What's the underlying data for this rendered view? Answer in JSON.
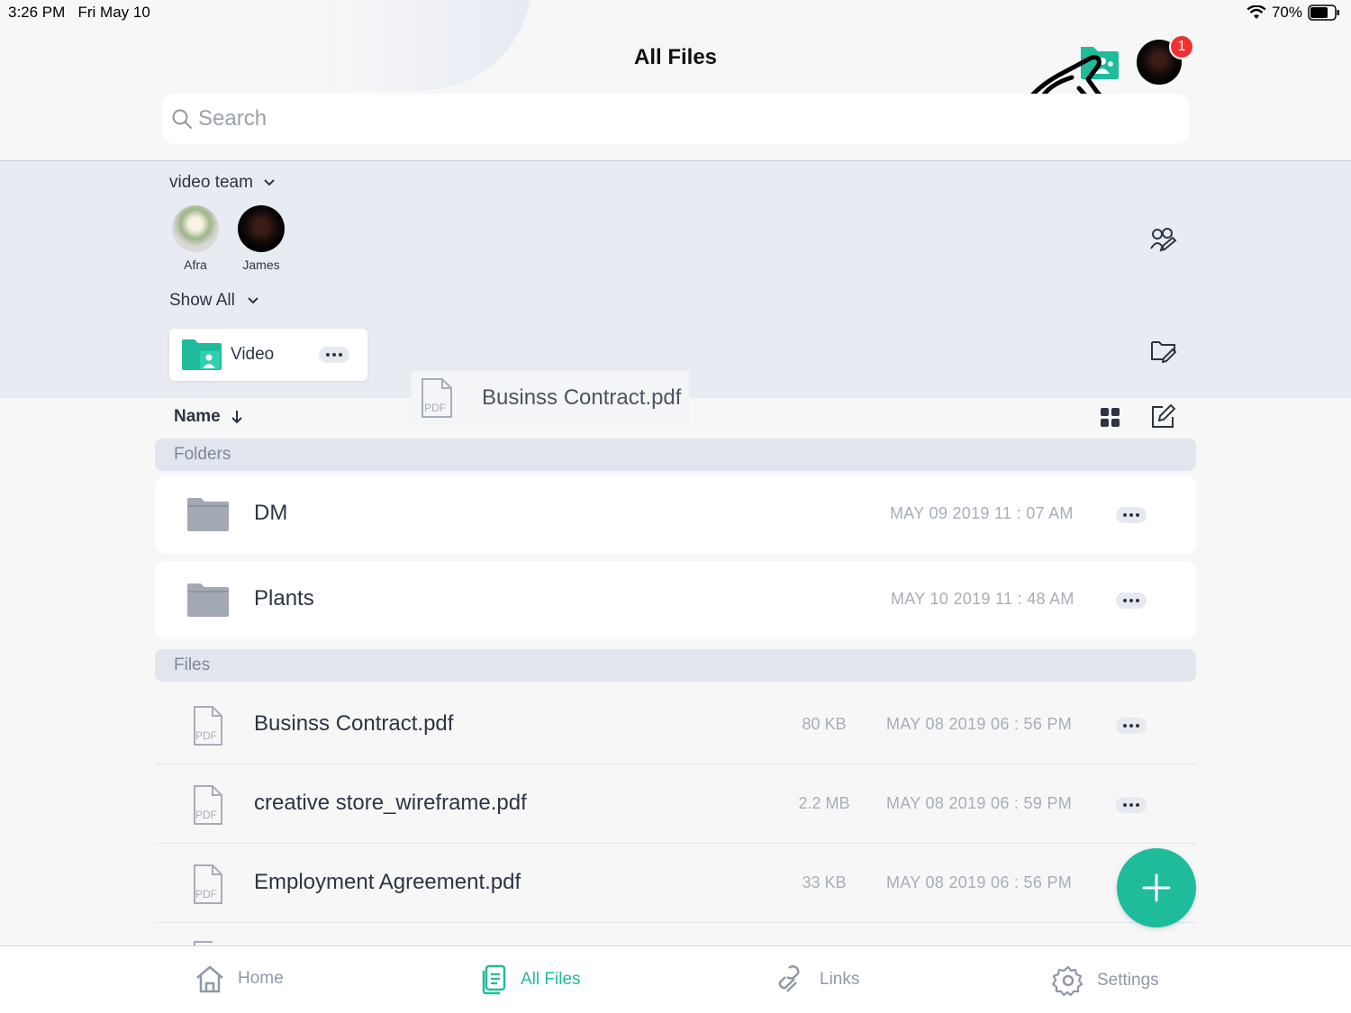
{
  "status": {
    "time": "3:26 PM",
    "date": "Fri May 10",
    "battery": "70%"
  },
  "header": {
    "title": "All Files",
    "notification_count": "1"
  },
  "search": {
    "placeholder": "Search"
  },
  "team": {
    "name": "video team",
    "members": [
      {
        "name": "Afra"
      },
      {
        "name": "James"
      }
    ],
    "show_all_label": "Show All",
    "shared_folder": {
      "label": "Video"
    }
  },
  "drag_ghost": {
    "label": "Businss Contract.pdf",
    "icon_text": "PDF"
  },
  "sort": {
    "label": "Name"
  },
  "sections": {
    "folders": "Folders",
    "files": "Files"
  },
  "folders": [
    {
      "name": "DM",
      "date": "MAY 09 2019 11 : 07 AM"
    },
    {
      "name": "Plants",
      "date": "MAY 10 2019 11 : 48 AM"
    }
  ],
  "files": [
    {
      "name": "Businss Contract.pdf",
      "size": "80 KB",
      "date": "MAY 08 2019 06 : 56 PM",
      "icon_text": "PDF"
    },
    {
      "name": "creative store_wireframe.pdf",
      "size": "2.2 MB",
      "date": "MAY 08 2019 06 : 59 PM",
      "icon_text": "PDF"
    },
    {
      "name": "Employment Agreement.pdf",
      "size": "33 KB",
      "date": "MAY 08 2019 06 : 56 PM",
      "icon_text": "PDF"
    }
  ],
  "tabs": [
    {
      "label": "Home",
      "icon": "home-icon"
    },
    {
      "label": "All Files",
      "icon": "all-files-icon"
    },
    {
      "label": "Links",
      "icon": "links-icon"
    },
    {
      "label": "Settings",
      "icon": "settings-icon"
    }
  ],
  "colors": {
    "accent": "#1fbc9c",
    "badge": "#f03232",
    "team_bg": "#e8ebf1"
  }
}
